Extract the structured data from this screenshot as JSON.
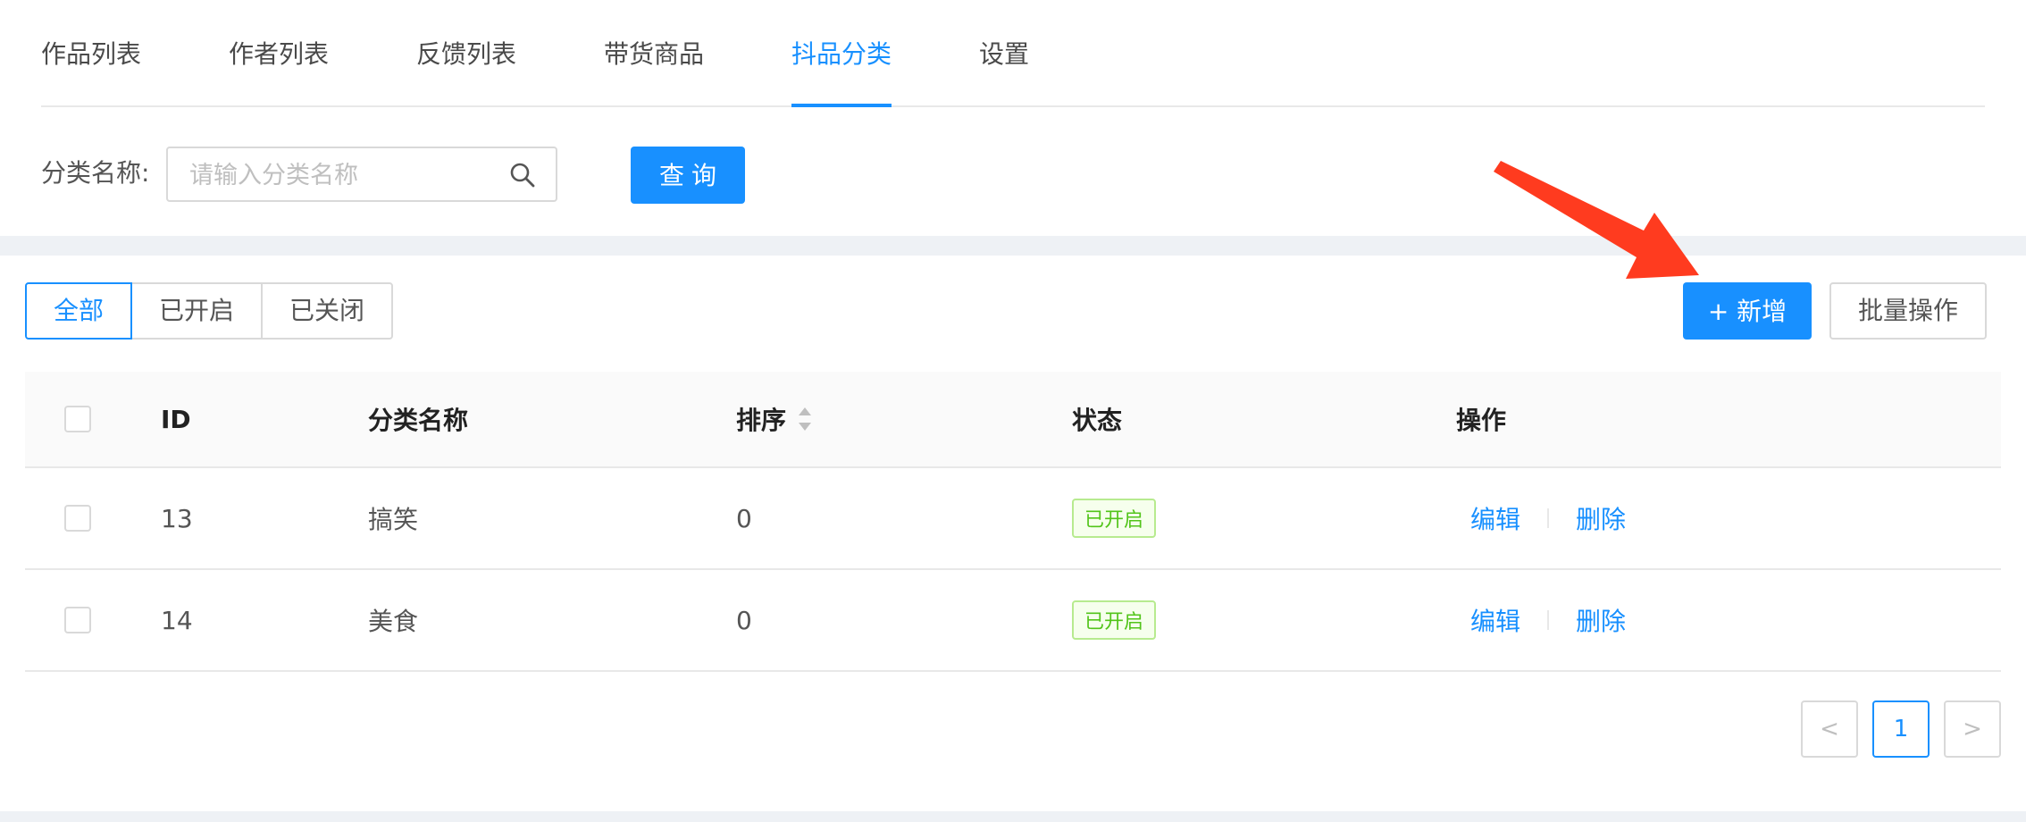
{
  "tabs": [
    {
      "label": "作品列表"
    },
    {
      "label": "作者列表"
    },
    {
      "label": "反馈列表"
    },
    {
      "label": "带货商品"
    },
    {
      "label": "抖品分类",
      "active": true
    },
    {
      "label": "设置"
    }
  ],
  "search": {
    "label": "分类名称:",
    "placeholder": "请输入分类名称",
    "value": "",
    "button": "查询"
  },
  "filters": [
    {
      "label": "全部",
      "active": true
    },
    {
      "label": "已开启"
    },
    {
      "label": "已关闭"
    }
  ],
  "actions": {
    "add": "+ 新增",
    "batch": "批量操作"
  },
  "table": {
    "columns": [
      "ID",
      "分类名称",
      "排序",
      "状态",
      "操作"
    ],
    "rows": [
      {
        "id": "13",
        "name": "搞笑",
        "sort": "0",
        "status": "已开启",
        "edit": "编辑",
        "delete": "删除"
      },
      {
        "id": "14",
        "name": "美食",
        "sort": "0",
        "status": "已开启",
        "edit": "编辑",
        "delete": "删除"
      }
    ]
  },
  "pagination": {
    "prev": "<",
    "current": "1",
    "next": ">"
  },
  "colors": {
    "primary": "#1890ff",
    "success": "#52c41a",
    "annotation": "#ff3b1f"
  }
}
